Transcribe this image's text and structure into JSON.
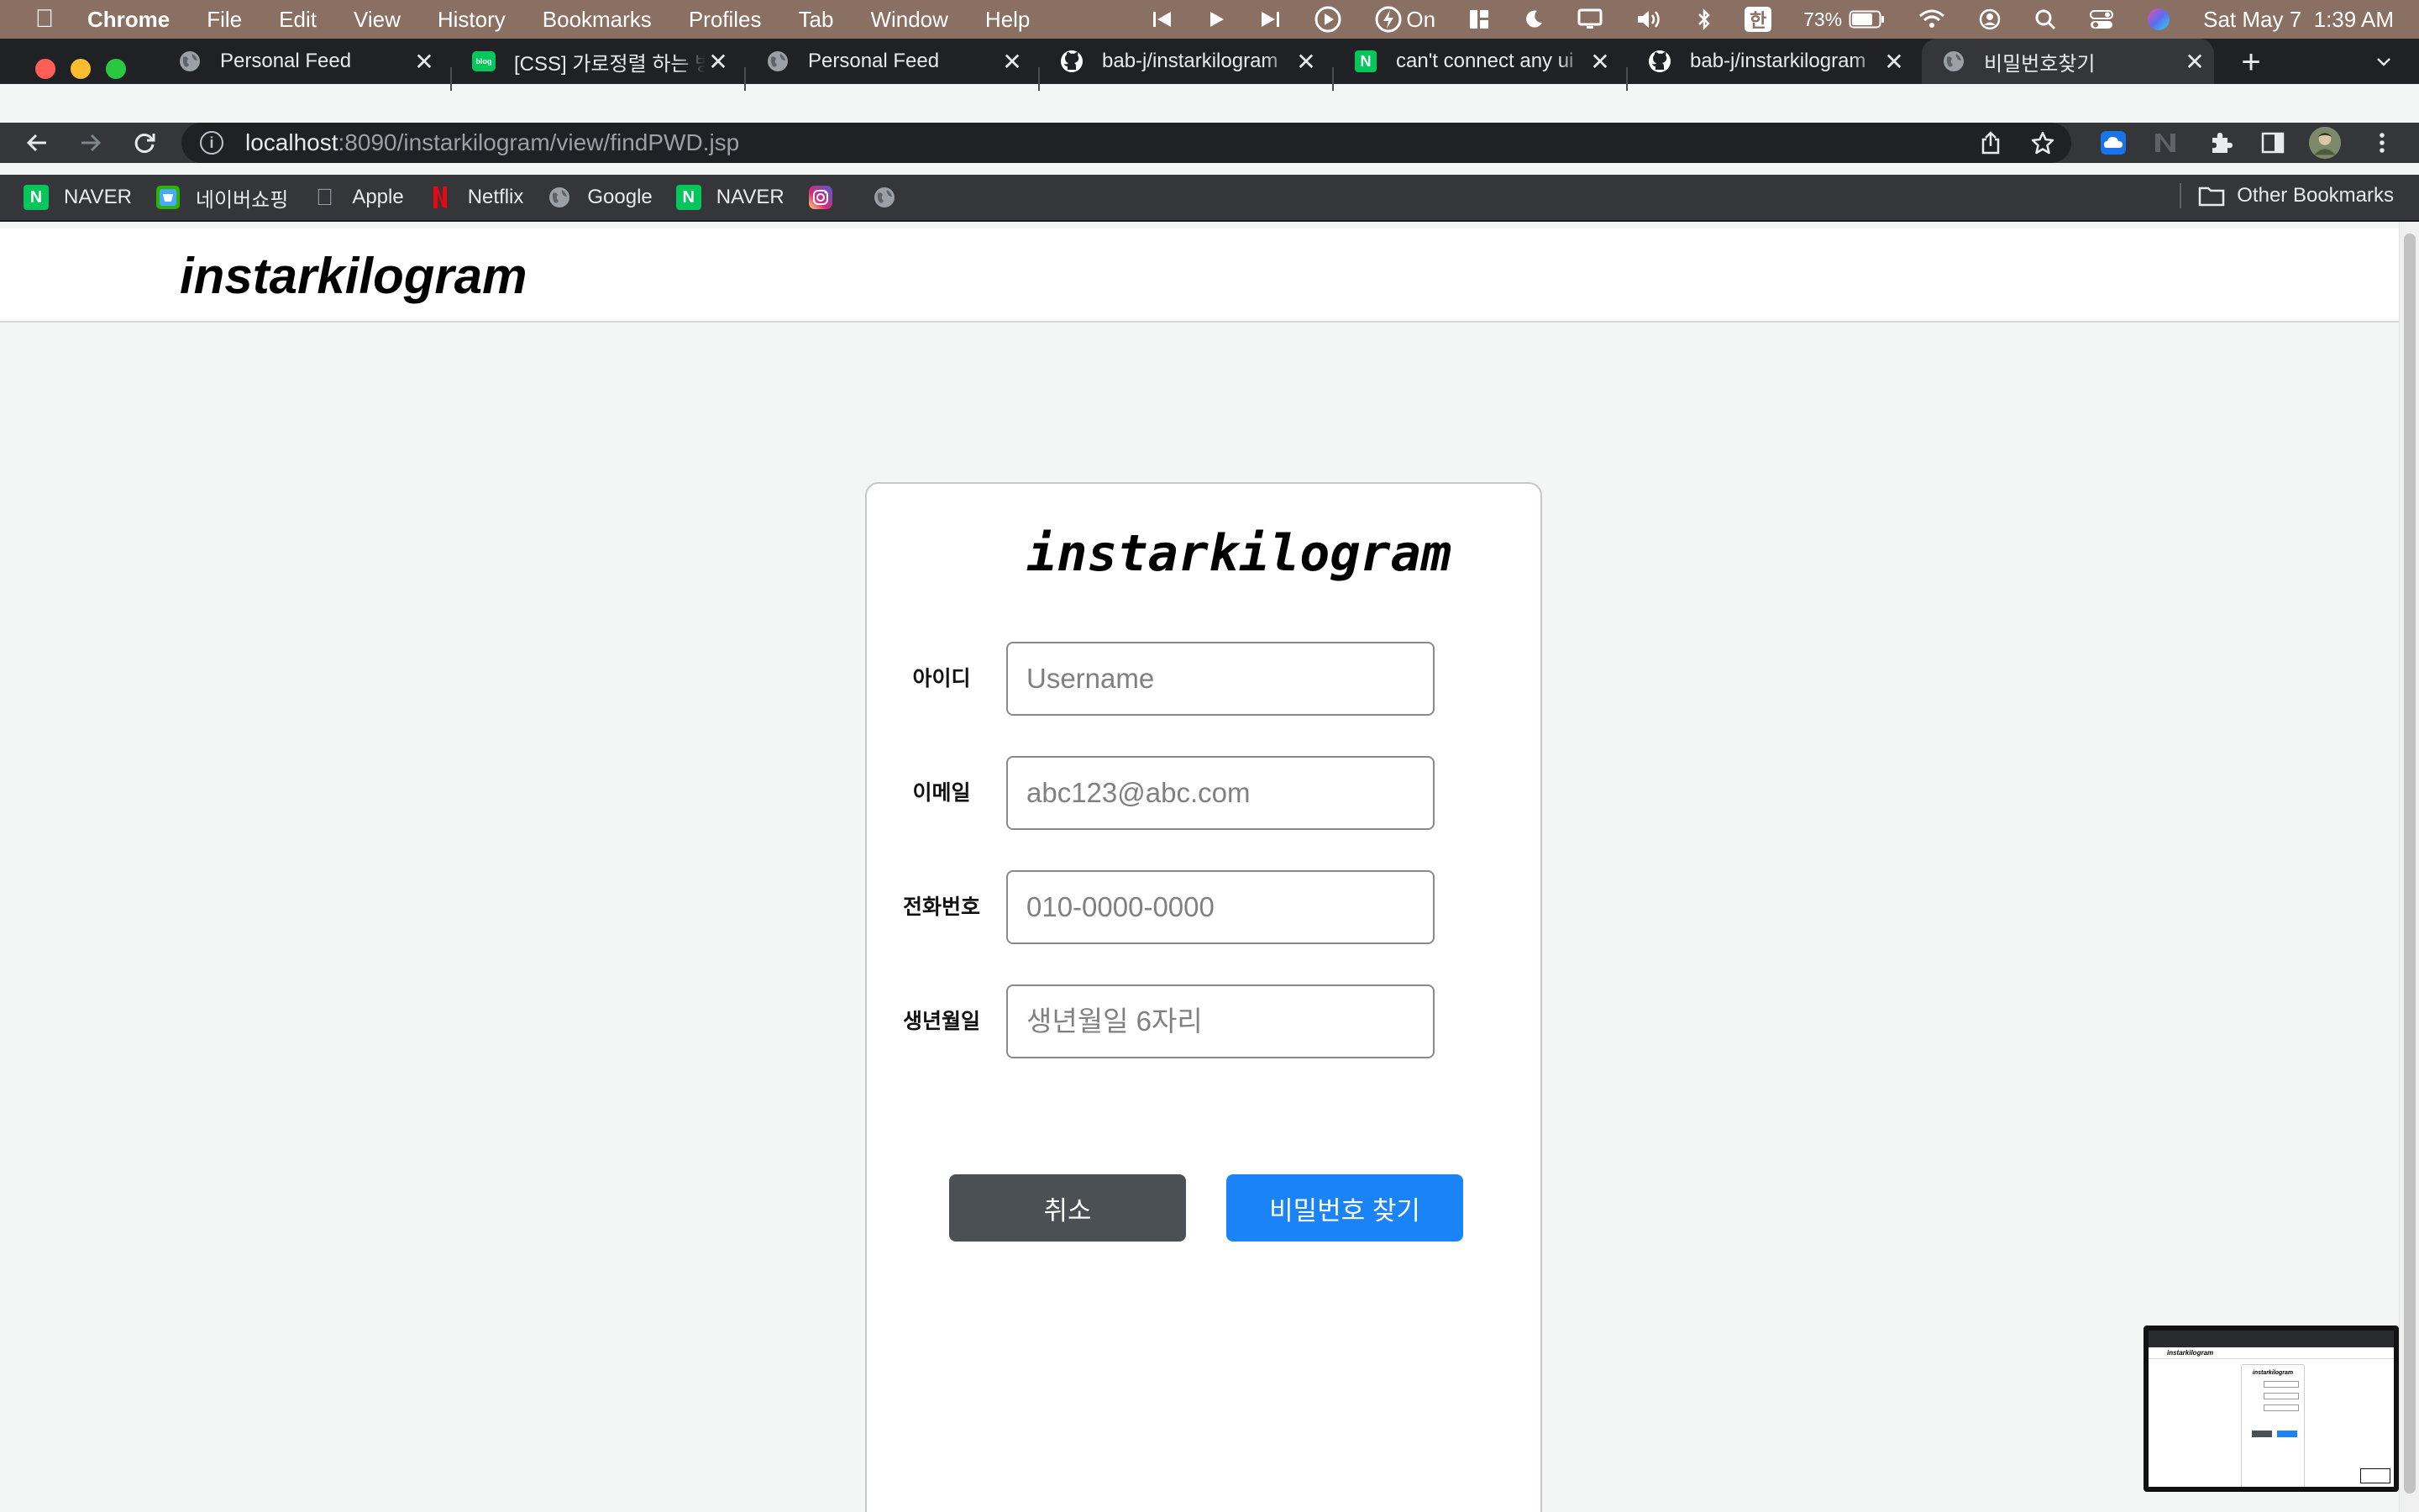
{
  "menubar": {
    "app": "Chrome",
    "items": [
      "File",
      "Edit",
      "View",
      "History",
      "Bookmarks",
      "Profiles",
      "Tab",
      "Window",
      "Help"
    ],
    "focus_label": "On",
    "input_source": "한",
    "battery": "73%",
    "datetime": "Sat May 7  1:39 AM"
  },
  "tabs": [
    {
      "title": "Personal Feed",
      "favicon": "globe-icon"
    },
    {
      "title": "[CSS] 가로정렬 하는 방법",
      "favicon": "naver-blog-icon",
      "favicon_text": "blog"
    },
    {
      "title": "Personal Feed",
      "favicon": "globe-icon"
    },
    {
      "title": "bab-j/instarkilogram",
      "favicon": "github-icon"
    },
    {
      "title": "can't connect any ui",
      "favicon": "naver-icon",
      "favicon_text": "N"
    },
    {
      "title": "bab-j/instarkilogram",
      "favicon": "github-icon"
    },
    {
      "title": "비밀번호찾기",
      "favicon": "globe-icon",
      "active": true
    }
  ],
  "address_bar": {
    "host": "localhost",
    "path": ":8090/instarkilogram/view/findPWD.jsp"
  },
  "bookmarks": [
    {
      "label": "NAVER",
      "icon": "naver-icon",
      "icon_text": "N"
    },
    {
      "label": "네이버쇼핑",
      "icon": "naver-shopping-icon"
    },
    {
      "label": "Apple",
      "icon": "apple-icon"
    },
    {
      "label": "Netflix",
      "icon": "netflix-icon"
    },
    {
      "label": "Google",
      "icon": "globe-icon"
    },
    {
      "label": "NAVER",
      "icon": "naver-icon",
      "icon_text": "N"
    },
    {
      "label": "",
      "icon": "instagram-icon"
    },
    {
      "label": "",
      "icon": "globe-icon"
    }
  ],
  "other_bookmarks": "Other Bookmarks",
  "page": {
    "header_logo": "instarkilogram",
    "card_logo": "instarkilogram",
    "fields": [
      {
        "label": "아이디",
        "placeholder": "Username",
        "value": ""
      },
      {
        "label": "이메일",
        "placeholder": "abc123@abc.com",
        "value": ""
      },
      {
        "label": "전화번호",
        "placeholder": "010-0000-0000",
        "value": ""
      },
      {
        "label": "생년월일",
        "placeholder": "생년월일 6자리",
        "value": ""
      }
    ],
    "cancel_button": "취소",
    "submit_button": "비밀번호 찾기"
  },
  "thumbnail": {
    "header_logo": "instarkilogram",
    "card_logo": "instarkilogram"
  },
  "colors": {
    "menubar": "#8a6f63",
    "tabstrip": "#202124",
    "toolbar": "#35363a",
    "cancel_button": "#4b5055",
    "submit_button": "#1a83f8",
    "page_bg": "#f4f6f5",
    "naver_green": "#03c75a"
  }
}
